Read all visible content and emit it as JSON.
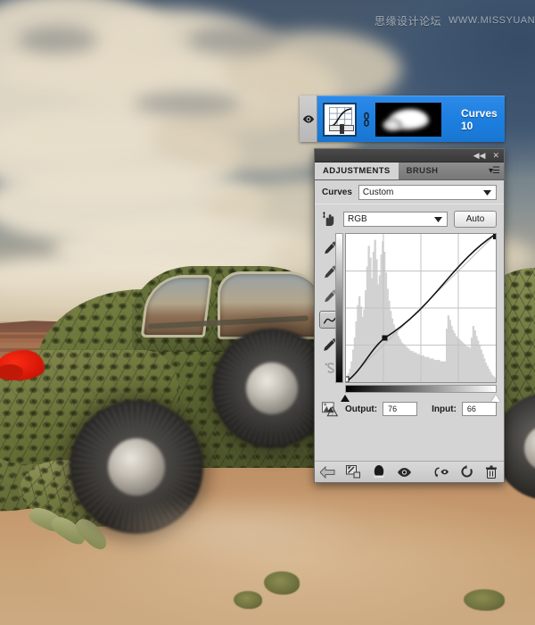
{
  "watermark": {
    "cn_text": "思缘设计论坛",
    "en_text": "WWW.MISSYUAN.COM"
  },
  "layer_row": {
    "visibility_icon": "eye-icon",
    "adjustment_thumbnail_icon": "curves-thumbnail-icon",
    "link_icon": "link-icon",
    "mask_thumbnail_icon": "layer-mask-thumbnail",
    "name": "Curves 10",
    "selected_color": "#1d7fe0"
  },
  "panel": {
    "titlebar": {
      "collapse_label": "◀◀",
      "close_label": "✕"
    },
    "tabs": [
      {
        "label": "ADJUSTMENTS",
        "active": true
      },
      {
        "label": "BRUSH",
        "active": false
      }
    ],
    "menu_icon": "panel-menu-icon",
    "curves_row": {
      "label": "Curves",
      "preset_value": "Custom",
      "caret_icon": "chevron-down-icon"
    },
    "channel_row": {
      "hand_icon": "on-image-adjust-hand-icon",
      "channel_value": "RGB",
      "caret_icon": "chevron-down-icon",
      "auto_label": "Auto"
    },
    "tools": [
      {
        "name": "black-point-eyedropper-icon",
        "selected": false
      },
      {
        "name": "gray-point-eyedropper-icon",
        "selected": false
      },
      {
        "name": "white-point-eyedropper-icon",
        "selected": false
      },
      {
        "name": "edit-points-curve-icon",
        "selected": true
      },
      {
        "name": "pencil-draw-curve-icon",
        "selected": false
      },
      {
        "name": "smooth-curve-icon",
        "selected": false
      }
    ],
    "io_row": {
      "clipping_warning_icon": "clipping-warning-icon",
      "output_label": "Output:",
      "output_value": "76",
      "input_label": "Input:",
      "input_value": "66"
    },
    "footer_buttons": [
      {
        "name": "return-to-adjustment-list-icon"
      },
      {
        "name": "clip-to-layer-icon"
      },
      {
        "name": "toggle-layer-mask-icon"
      },
      {
        "name": "preview-eye-icon"
      },
      {
        "name": "view-previous-state-icon"
      },
      {
        "name": "reset-adjustment-icon"
      },
      {
        "name": "delete-adjustment-layer-icon"
      }
    ]
  },
  "chart_data": {
    "type": "line",
    "title": "Curves RGB",
    "xlabel": "Input",
    "ylabel": "Output",
    "xlim": [
      0,
      255
    ],
    "ylim": [
      0,
      255
    ],
    "grid": true,
    "grid_divisions": 4,
    "control_points": [
      {
        "input": 0,
        "output": 0
      },
      {
        "input": 66,
        "output": 76
      },
      {
        "input": 255,
        "output": 255
      }
    ],
    "histogram": [
      4,
      6,
      9,
      14,
      22,
      30,
      41,
      52,
      58,
      51,
      44,
      49,
      62,
      78,
      92,
      84,
      70,
      88,
      96,
      83,
      66,
      72,
      86,
      95,
      88,
      74,
      63,
      55,
      48,
      43,
      39,
      36,
      34,
      31,
      29,
      27,
      26,
      25,
      24,
      23,
      22,
      21,
      21,
      20,
      20,
      19,
      19,
      18,
      18,
      18,
      17,
      17,
      17,
      16,
      16,
      16,
      15,
      15,
      15,
      15,
      14,
      14,
      14,
      14,
      36,
      45,
      42,
      38,
      35,
      33,
      31,
      30,
      29,
      28,
      27,
      26,
      25,
      24,
      24,
      23,
      30,
      38,
      35,
      31,
      28,
      25,
      22,
      19,
      16,
      13,
      11,
      9,
      7,
      5,
      4,
      3
    ]
  }
}
